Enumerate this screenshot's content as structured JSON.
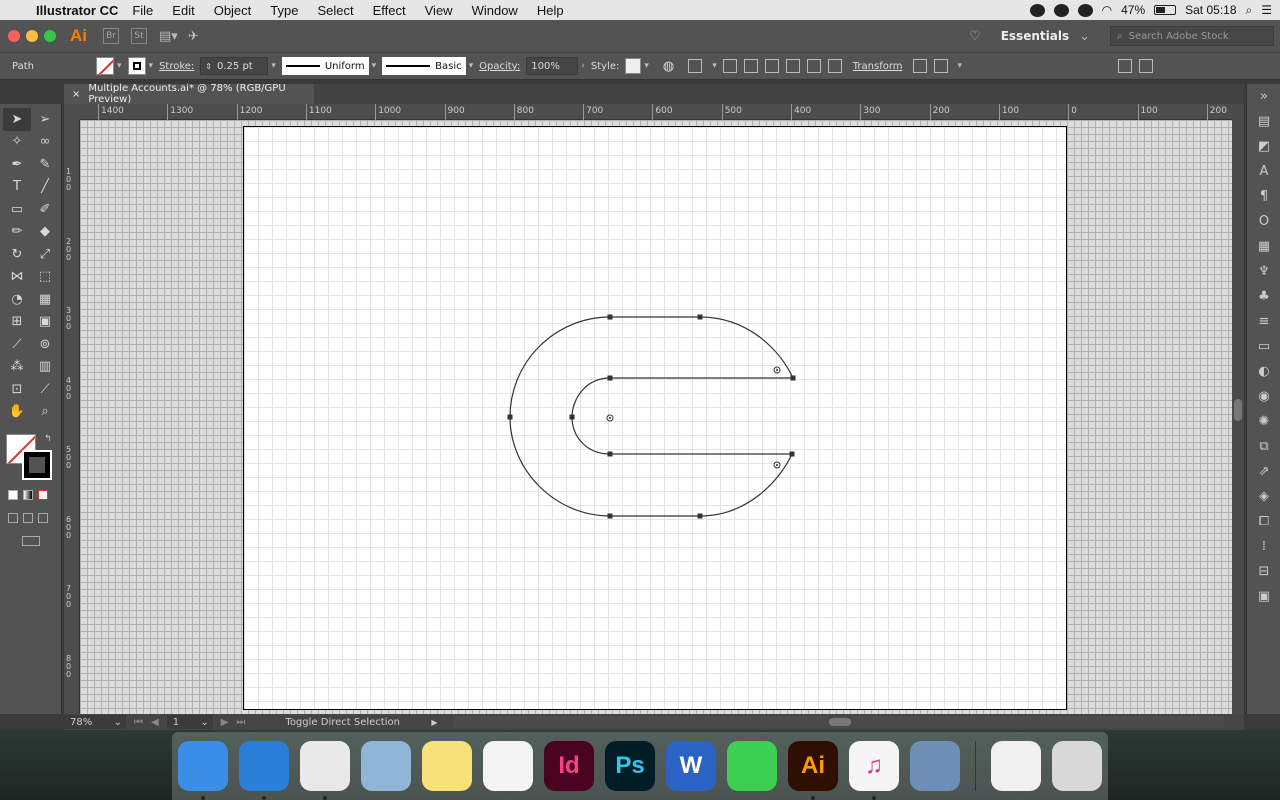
{
  "menubar": {
    "app_name": "Illustrator CC",
    "items": [
      "File",
      "Edit",
      "Object",
      "Type",
      "Select",
      "Effect",
      "View",
      "Window",
      "Help"
    ],
    "battery": "47%",
    "clock": "Sat 05:18"
  },
  "appbar": {
    "logo": "Ai",
    "bridge": "Br",
    "stock_btn": "St",
    "workspace": "Essentials",
    "search_placeholder": "Search Adobe Stock"
  },
  "control": {
    "object_type": "Path",
    "stroke_label": "Stroke:",
    "stroke_weight": "0.25 pt",
    "profile": "Uniform",
    "brush": "Basic",
    "opacity_label": "Opacity:",
    "opacity": "100%",
    "style_label": "Style:",
    "transform": "Transform"
  },
  "document": {
    "tab_title": "Multiple Accounts.ai* @ 78% (RGB/GPU Preview)",
    "close": "×"
  },
  "rulers": {
    "top": [
      "1400",
      "1300",
      "1200",
      "1100",
      "1000",
      "900",
      "800",
      "700",
      "600",
      "500",
      "400",
      "300",
      "200",
      "100",
      "0",
      "100",
      "200"
    ],
    "left": [
      "100",
      "200",
      "300",
      "400",
      "500",
      "600",
      "700",
      "800"
    ]
  },
  "status": {
    "zoom": "78%",
    "artboard_num": "1",
    "hint": "Toggle Direct Selection"
  },
  "dock": {
    "apps": [
      {
        "name": "Finder",
        "label": "",
        "bg": "#3a8ee6",
        "fg": "#fff",
        "running": true
      },
      {
        "name": "Safari",
        "label": "",
        "bg": "#2a7fd8",
        "fg": "#fff",
        "running": true
      },
      {
        "name": "Chrome",
        "label": "",
        "bg": "#e9e9e9",
        "fg": "#d33",
        "running": true
      },
      {
        "name": "Mail",
        "label": "",
        "bg": "#8fb6d6",
        "fg": "#333",
        "running": false
      },
      {
        "name": "Notes",
        "label": "",
        "bg": "#f7e27a",
        "fg": "#555",
        "running": false
      },
      {
        "name": "Reminders",
        "label": "",
        "bg": "#f4f4f4",
        "fg": "#555",
        "running": false
      },
      {
        "name": "InDesign",
        "label": "Id",
        "bg": "#49021f",
        "fg": "#ff3d8b",
        "running": false
      },
      {
        "name": "Photoshop",
        "label": "Ps",
        "bg": "#001d26",
        "fg": "#31c5f0",
        "running": false
      },
      {
        "name": "Word",
        "label": "W",
        "bg": "#2b63c4",
        "fg": "#fff",
        "running": false
      },
      {
        "name": "FaceTime",
        "label": "",
        "bg": "#3ccf52",
        "fg": "#fff",
        "running": false
      },
      {
        "name": "Illustrator",
        "label": "Ai",
        "bg": "#2e0f00",
        "fg": "#ff9a00",
        "running": true
      },
      {
        "name": "iTunes",
        "label": "♫",
        "bg": "#f5f5f5",
        "fg": "#e0348b",
        "running": true
      },
      {
        "name": "Preview",
        "label": "",
        "bg": "#6d8fb5",
        "fg": "#fff",
        "running": false
      }
    ],
    "docs": [
      {
        "name": "Document",
        "label": "",
        "bg": "#f0f0f0",
        "fg": "#666"
      },
      {
        "name": "Trash",
        "label": "",
        "bg": "#d8d8d8",
        "fg": "#666"
      }
    ]
  }
}
